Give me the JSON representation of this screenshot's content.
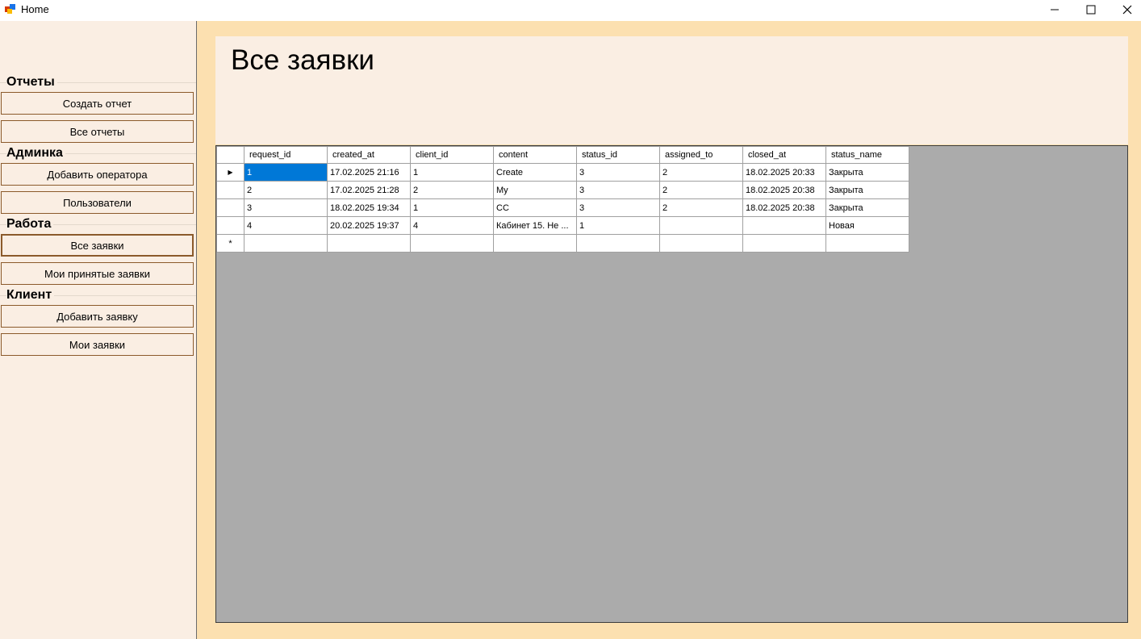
{
  "window": {
    "title": "Home",
    "app_icon": "app-window-icon",
    "controls": [
      "minimize-icon",
      "maximize-icon",
      "close-icon"
    ]
  },
  "sidebar": {
    "groups": [
      {
        "label": "Отчеты",
        "buttons": [
          "Создать отчет",
          "Все отчеты"
        ]
      },
      {
        "label": "Админка",
        "buttons": [
          "Добавить оператора",
          "Пользователи"
        ]
      },
      {
        "label": "Работа",
        "buttons": [
          "Все заявки",
          "Мои принятые заявки"
        ]
      },
      {
        "label": "Клиент",
        "buttons": [
          "Добавить заявку",
          "Мои заявки"
        ]
      }
    ],
    "active_button": "Все заявки"
  },
  "main": {
    "title": "Все заявки",
    "table": {
      "columns": [
        "request_id",
        "created_at",
        "client_id",
        "content",
        "status_id",
        "assigned_to",
        "closed_at",
        "status_name"
      ],
      "rows": [
        [
          "1",
          "17.02.2025 21:16",
          "1",
          "Create",
          "3",
          "2",
          "18.02.2025 20:33",
          "Закрыта"
        ],
        [
          "2",
          "17.02.2025 21:28",
          "2",
          "My",
          "3",
          "2",
          "18.02.2025 20:38",
          "Закрыта"
        ],
        [
          "3",
          "18.02.2025 19:34",
          "1",
          "CC",
          "3",
          "2",
          "18.02.2025 20:38",
          "Закрыта"
        ],
        [
          "4",
          "20.02.2025 19:37",
          "4",
          "Кабинет 15. Не ...",
          "1",
          "",
          "",
          "Новая"
        ]
      ],
      "current_row_marker": "▶",
      "new_row_marker": "*",
      "selected_cell": {
        "row": 0,
        "col": 0
      }
    }
  },
  "colors": {
    "sidebar_bg": "#faeee3",
    "main_bg": "#fce0b0",
    "button_border": "#8b5a2b",
    "grid_bg": "#ababab",
    "selection": "#0078d7"
  }
}
